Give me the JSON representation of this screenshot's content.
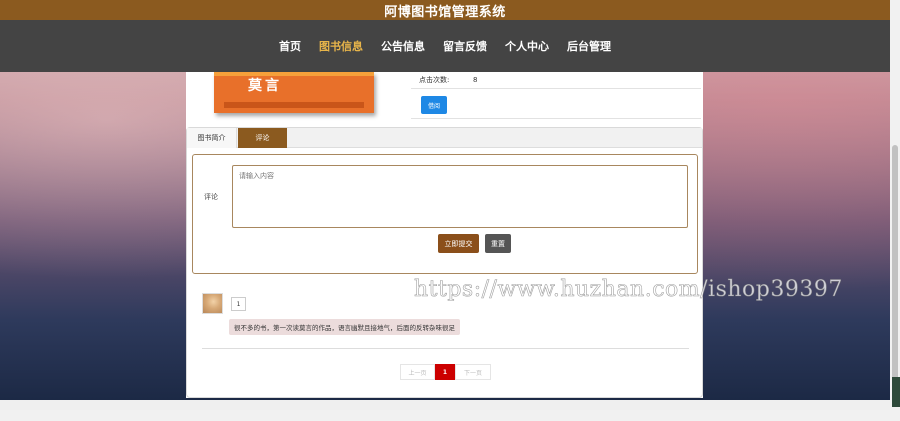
{
  "header": {
    "title": "阿博图书馆管理系统"
  },
  "nav": {
    "items": [
      {
        "label": "首页"
      },
      {
        "label": "图书信息"
      },
      {
        "label": "公告信息"
      },
      {
        "label": "留言反馈"
      },
      {
        "label": "个人中心"
      },
      {
        "label": "后台管理"
      }
    ],
    "active_index": 1,
    "active_color": "#e8b54a"
  },
  "book": {
    "cover_title": "莫言",
    "click_label": "点击次数:",
    "click_count": "8",
    "borrow_label": "借阅"
  },
  "tabs": [
    {
      "label": "图书简介"
    },
    {
      "label": "评论"
    }
  ],
  "comment_form": {
    "label": "评论",
    "placeholder": "请输入内容",
    "submit_label": "立即提交",
    "reset_label": "重置"
  },
  "comments": [
    {
      "user": "1",
      "text": "很不多的书，第一次读莫言的作品，语言幽默且接地气，后面的反转杂味很足"
    }
  ],
  "pager": {
    "prev": "上一页",
    "current": "1",
    "next": "下一页"
  },
  "watermark": "https://www.huzhan.com/ishop39397",
  "colors": {
    "brand": "#8b5a1f",
    "nav_bg": "#444444",
    "borrow_button": "#1e88e5",
    "current_page": "#cc0000"
  }
}
